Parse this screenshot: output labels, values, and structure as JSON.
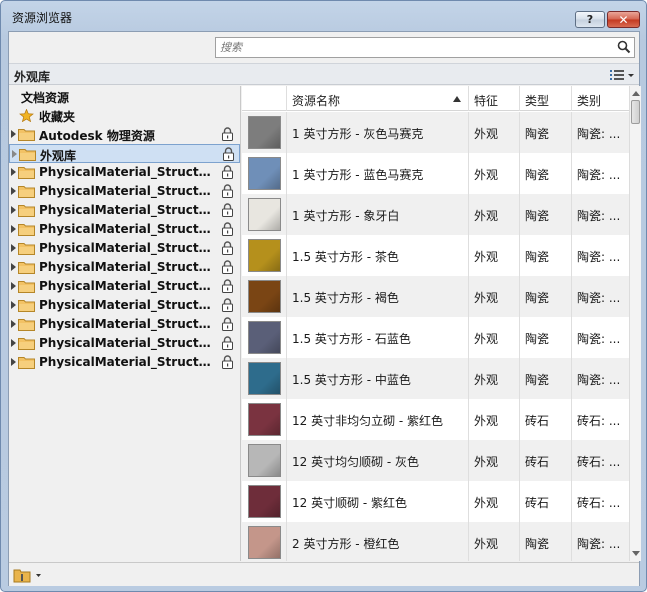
{
  "window": {
    "title": "资源浏览器",
    "help_label": "?",
    "close_label": "✕"
  },
  "search": {
    "placeholder": "搜索",
    "value": ""
  },
  "library_header": {
    "label": "外观库"
  },
  "tree": {
    "items": [
      {
        "label": "文档资源",
        "kind": "plain",
        "locked": false,
        "selected": false
      },
      {
        "label": "收藏夹",
        "kind": "star",
        "locked": false,
        "selected": false
      },
      {
        "label": "Autodesk 物理资源",
        "kind": "folder",
        "locked": true,
        "selected": false
      },
      {
        "label": "外观库",
        "kind": "folder",
        "locked": true,
        "selected": true
      },
      {
        "label": "PhysicalMaterial_Structural...",
        "kind": "folder",
        "locked": true,
        "selected": false
      },
      {
        "label": "PhysicalMaterial_Structural...",
        "kind": "folder",
        "locked": true,
        "selected": false
      },
      {
        "label": "PhysicalMaterial_Structural...",
        "kind": "folder",
        "locked": true,
        "selected": false
      },
      {
        "label": "PhysicalMaterial_Structural...",
        "kind": "folder",
        "locked": true,
        "selected": false
      },
      {
        "label": "PhysicalMaterial_Structural...",
        "kind": "folder",
        "locked": true,
        "selected": false
      },
      {
        "label": "PhysicalMaterial_Structural...",
        "kind": "folder",
        "locked": true,
        "selected": false
      },
      {
        "label": "PhysicalMaterial_Structural...",
        "kind": "folder",
        "locked": true,
        "selected": false
      },
      {
        "label": "PhysicalMaterial_Structural...",
        "kind": "folder",
        "locked": true,
        "selected": false
      },
      {
        "label": "PhysicalMaterial_Structural...",
        "kind": "folder",
        "locked": true,
        "selected": false
      },
      {
        "label": "PhysicalMaterial_Structural...",
        "kind": "folder",
        "locked": true,
        "selected": false
      },
      {
        "label": "PhysicalMaterial_Structural...",
        "kind": "folder",
        "locked": true,
        "selected": false
      }
    ]
  },
  "grid": {
    "columns": {
      "name": "资源名称",
      "feature": "特征",
      "type": "类型",
      "category": "类别"
    },
    "sort": {
      "column": "name",
      "direction": "ascending"
    },
    "rows": [
      {
        "name": "1 英寸方形 - 灰色马赛克",
        "feature": "外观",
        "type": "陶瓷",
        "category": "陶瓷: ...",
        "swatch": "#7d7d7d"
      },
      {
        "name": "1 英寸方形 - 蓝色马赛克",
        "feature": "外观",
        "type": "陶瓷",
        "category": "陶瓷: ...",
        "swatch": "#6f8fb8"
      },
      {
        "name": "1 英寸方形 - 象牙白",
        "feature": "外观",
        "type": "陶瓷",
        "category": "陶瓷: ...",
        "swatch": "#e8e6e0"
      },
      {
        "name": "1.5 英寸方形 - 茶色",
        "feature": "外观",
        "type": "陶瓷",
        "category": "陶瓷: ...",
        "swatch": "#b5901c"
      },
      {
        "name": "1.5 英寸方形 - 褐色",
        "feature": "外观",
        "type": "陶瓷",
        "category": "陶瓷: ...",
        "swatch": "#7a4514"
      },
      {
        "name": "1.5 英寸方形 - 石蓝色",
        "feature": "外观",
        "type": "陶瓷",
        "category": "陶瓷: ...",
        "swatch": "#5a5f78"
      },
      {
        "name": "1.5 英寸方形 - 中蓝色",
        "feature": "外观",
        "type": "陶瓷",
        "category": "陶瓷: ...",
        "swatch": "#2e6c8c"
      },
      {
        "name": "12 英寸非均匀立砌 - 紫红色",
        "feature": "外观",
        "type": "砖石",
        "category": "砖石: ...",
        "swatch": "#7a3340"
      },
      {
        "name": "12 英寸均匀顺砌 - 灰色",
        "feature": "外观",
        "type": "砖石",
        "category": "砖石: ...",
        "swatch": "#b7b7b7"
      },
      {
        "name": "12 英寸顺砌 - 紫红色",
        "feature": "外观",
        "type": "砖石",
        "category": "砖石: ...",
        "swatch": "#6e2d3a"
      },
      {
        "name": "2 英寸方形 - 橙红色",
        "feature": "外观",
        "type": "陶瓷",
        "category": "陶瓷: ...",
        "swatch": "#c4968a"
      }
    ]
  },
  "colors": {
    "title_bar": "#b9cbe1",
    "close_button": "#c3381f",
    "selection": "#cfe0f3",
    "folder": "#e9b44c"
  }
}
